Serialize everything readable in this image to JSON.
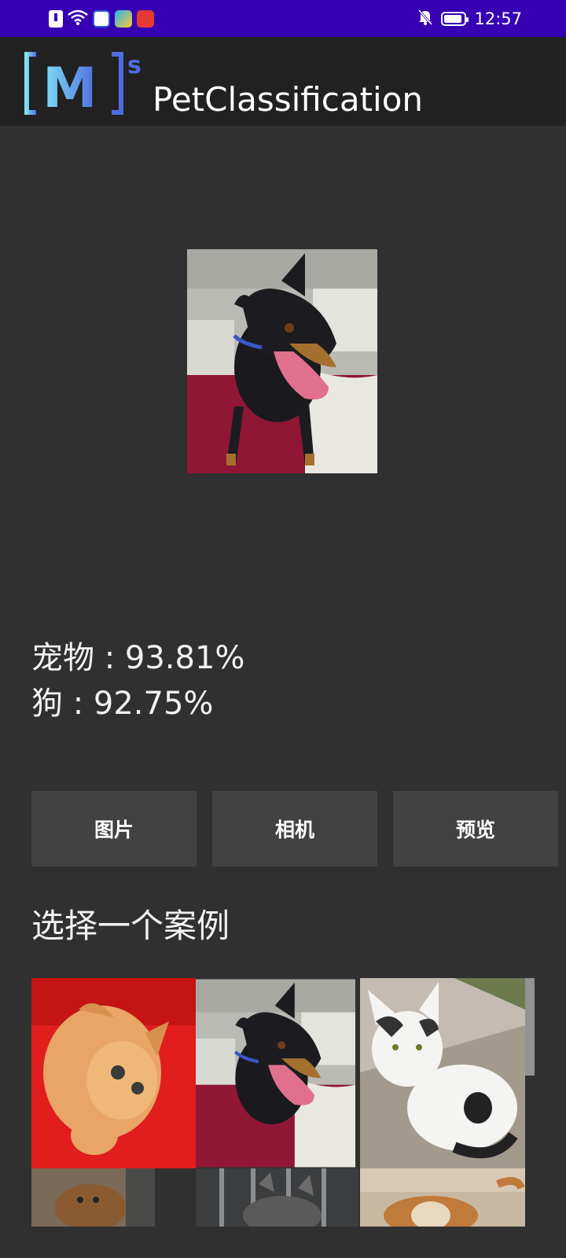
{
  "status_bar": {
    "time": "12:57",
    "left_icons": [
      "notification-icon",
      "wifi-icon",
      "baidu-app-icon",
      "browser-app-icon",
      "redbook-app-icon"
    ],
    "right_icons": [
      "bell-off-icon",
      "battery-icon"
    ],
    "background": "#3700b3"
  },
  "app_bar": {
    "logo_text": "[M]",
    "logo_superscript": "s",
    "title": "PetClassification",
    "background": "#212121"
  },
  "results": [
    {
      "label": "宠物 : 93.81%"
    },
    {
      "label": "狗 : 92.75%"
    }
  ],
  "buttons": {
    "image": "图片",
    "camera": "相机",
    "preview": "预览"
  },
  "examples": {
    "title": "选择一个案例"
  },
  "colors": {
    "background": "#303030",
    "button": "#424242",
    "text": "#ffffff"
  }
}
